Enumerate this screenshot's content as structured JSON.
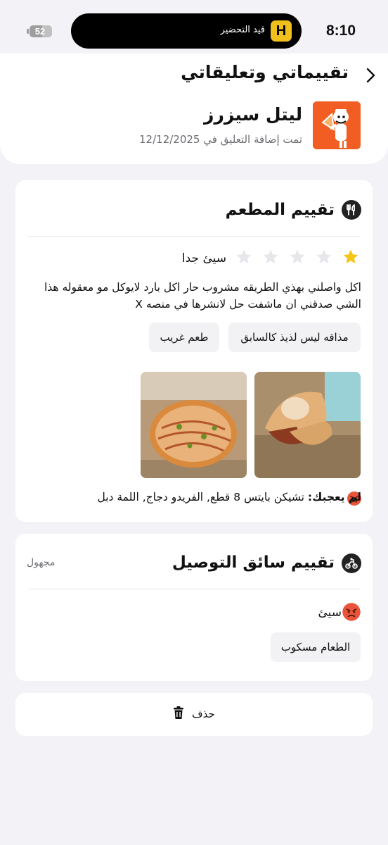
{
  "status_bar": {
    "time": "8:10",
    "battery": "52",
    "live_activity_logo": "H",
    "live_activity_text": "قيد التحضير"
  },
  "header": {
    "title": "تقييماتي وتعليقاتي",
    "restaurant_name": "ليتل سيزرز",
    "comment_date": "تمت إضافة التعليق في 12/12/2025"
  },
  "restaurant_review": {
    "section_title": "تقييم المطعم",
    "stars_filled": 1,
    "stars_total": 5,
    "rating_label": "سيئ جدا",
    "comment": "اكل واصلني بهذي الطريقه مشروب حار اكل بارد لايوكل مو معقوله هذا الشي صدقني ان ماشفت حل لانشرها في منصه X",
    "tags": [
      "مذاقه ليس لذيذ كالسابق",
      "طعم غريب"
    ],
    "disliked_label": "لم يعجبك:",
    "disliked_items": "تشيكن بايتس 8 قطع, الفريدو دجاج, اللمة دبل"
  },
  "driver_review": {
    "section_title": "تقييم سائق التوصيل",
    "anonymous_label": "مجهول",
    "rating_label": "سيئ",
    "tags": [
      "الطعام مسكوب"
    ]
  },
  "delete_label": "حذف",
  "colors": {
    "star_filled": "#f5c518",
    "star_empty": "#e6e6eb",
    "brand_orange": "#f15d22",
    "emoji_red": "#e8553a"
  }
}
